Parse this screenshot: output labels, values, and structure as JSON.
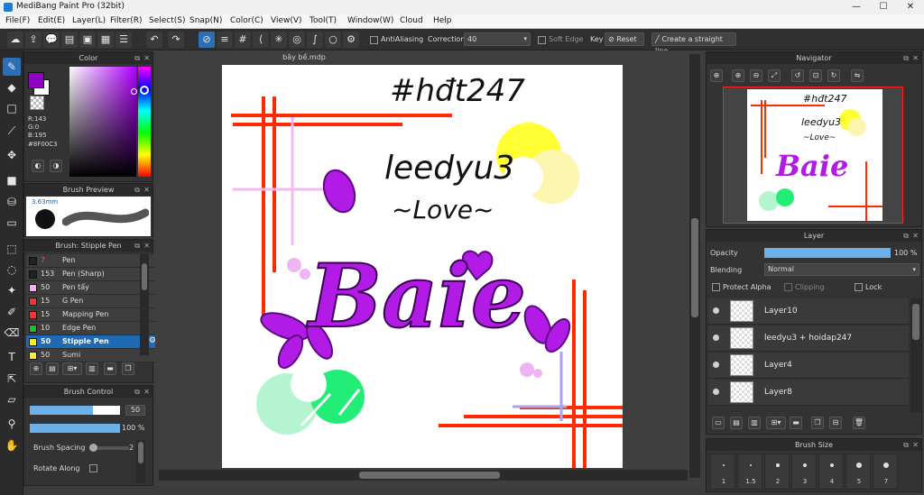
{
  "window": {
    "title": "MediBang Paint Pro (32bit)",
    "minimize": "—",
    "maximize": "☐",
    "close": "✕"
  },
  "menu": [
    "File(F)",
    "Edit(E)",
    "Layer(L)",
    "Filter(R)",
    "Select(S)",
    "Snap(N)",
    "Color(C)",
    "View(V)",
    "Tool(T)",
    "Window(W)",
    "Cloud",
    "Help"
  ],
  "toolbar": {
    "antialiasing": "AntiAliasing",
    "correction_label": "Correction",
    "correction_value": "40",
    "soft_edge": "Soft Edge",
    "key_label": "Key",
    "reset": "Reset",
    "straight_line": "Create a straight line"
  },
  "color_panel": {
    "title": "Color",
    "r": "R:143",
    "g": "G:0",
    "b": "B:195",
    "hex": "#8F00C3",
    "primary": "#8F00C3",
    "secondary": "#ffffff"
  },
  "brush_preview": {
    "title": "Brush Preview",
    "size": "3.63mm"
  },
  "brush_list": {
    "title": "Brush: Stipple Pen",
    "items": [
      {
        "size": "7",
        "name": "Pen",
        "color": "#222222",
        "size_color": "#ff5050"
      },
      {
        "size": "153",
        "name": "Pen (Sharp)",
        "color": "#222222",
        "size_color": "#dddddd"
      },
      {
        "size": "50",
        "name": "Pen tẩy",
        "color": "#f4b0f4",
        "size_color": "#dddddd"
      },
      {
        "size": "15",
        "name": "G Pen",
        "color": "#ff3030",
        "size_color": "#dddddd"
      },
      {
        "size": "15",
        "name": "Mapping Pen",
        "color": "#ff3030",
        "size_color": "#dddddd"
      },
      {
        "size": "10",
        "name": "Edge Pen",
        "color": "#22bb22",
        "size_color": "#dddddd"
      },
      {
        "size": "50",
        "name": "Stipple Pen",
        "color": "#ffee22",
        "size_color": "#ffffff"
      },
      {
        "size": "50",
        "name": "Sumi",
        "color": "#ffee22",
        "size_color": "#dddddd"
      }
    ]
  },
  "brush_control": {
    "title": "Brush Control",
    "size_value": "50",
    "opacity_value": "100 %",
    "size_fill": 0.7,
    "opacity_fill": 1.0,
    "spacing_label": "Brush Spacing",
    "spacing_value": "2",
    "rotate_label": "Rotate Along"
  },
  "document": {
    "tab": "bây bề.mdp",
    "texts": {
      "hashtag": "#hđt247",
      "name": "leedyu3",
      "love": "~Love~",
      "baie": "Baie"
    }
  },
  "navigator": {
    "title": "Navigator"
  },
  "layer_panel": {
    "title": "Layer",
    "opacity_label": "Opacity",
    "opacity_value": "100 %",
    "opacity_fill": 1.0,
    "blending_label": "Blending",
    "blending_value": "Normal",
    "protect_alpha": "Protect Alpha",
    "clipping": "Clipping",
    "lock": "Lock",
    "layers": [
      "Layer10",
      "leedyu3 + hoidap247",
      "Layer4",
      "Layer8"
    ]
  },
  "brush_size_panel": {
    "title": "Brush Size",
    "sizes": [
      "1",
      "1.5",
      "2",
      "3",
      "4",
      "5",
      "7"
    ]
  }
}
